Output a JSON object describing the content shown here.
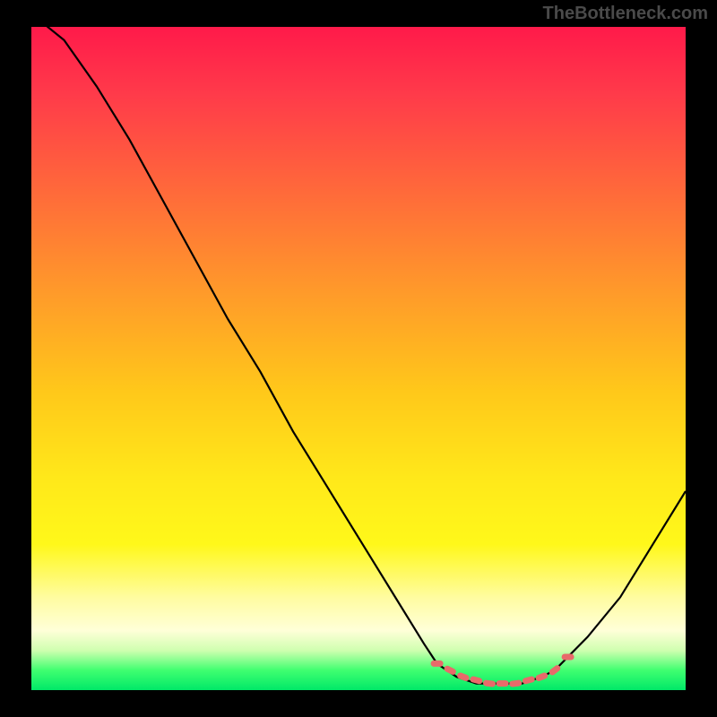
{
  "watermark": "TheBottleneck.com",
  "chart_data": {
    "type": "line",
    "title": "",
    "xlabel": "",
    "ylabel": "",
    "xlim": [
      0,
      100
    ],
    "ylim": [
      0,
      100
    ],
    "series": [
      {
        "name": "bottleneck-curve",
        "x": [
          0,
          5,
          10,
          15,
          20,
          25,
          30,
          35,
          40,
          45,
          50,
          55,
          60,
          62,
          65,
          68,
          70,
          72,
          75,
          78,
          80,
          82,
          85,
          90,
          95,
          100
        ],
        "y": [
          102,
          98,
          91,
          83,
          74,
          65,
          56,
          48,
          39,
          31,
          23,
          15,
          7,
          4,
          2,
          1,
          1,
          1,
          1,
          2,
          3,
          5,
          8,
          14,
          22,
          30
        ]
      }
    ],
    "markers": {
      "name": "highlight-range",
      "color": "#e86a6a",
      "x": [
        62,
        64,
        66,
        68,
        70,
        72,
        74,
        76,
        78,
        80,
        82
      ],
      "y": [
        4,
        3,
        2,
        1.5,
        1,
        1,
        1,
        1.5,
        2,
        3,
        5
      ]
    },
    "background_gradient": [
      "#ff1a4a",
      "#ffc81a",
      "#fff81a",
      "#00e868"
    ]
  }
}
